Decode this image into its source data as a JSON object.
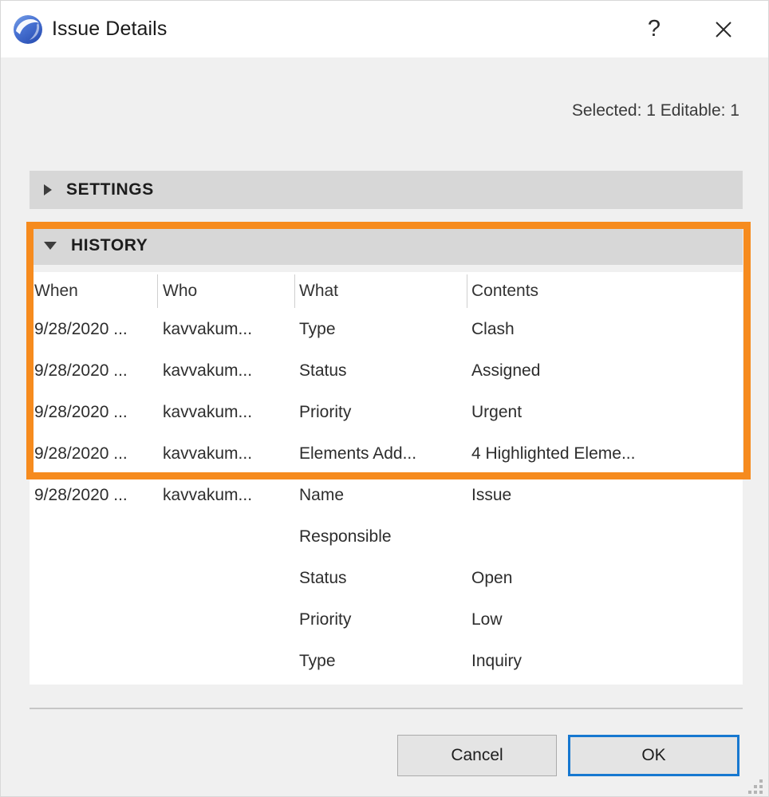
{
  "window": {
    "title": "Issue Details",
    "app_icon": "archicad-issue-icon",
    "help_label": "?",
    "close_label": "✕"
  },
  "status": {
    "text": "Selected: 1 Editable: 1"
  },
  "sections": [
    {
      "label": "SETTINGS",
      "expanded": false,
      "icon": "triangle-right-icon"
    },
    {
      "label": "HISTORY",
      "expanded": true,
      "icon": "triangle-down-icon"
    }
  ],
  "history_table": {
    "columns": [
      "When",
      "Who",
      "What",
      "Contents"
    ],
    "rows": [
      {
        "when": "9/28/2020 ...",
        "who": "kavvakum...",
        "what": "Type",
        "contents": "Clash"
      },
      {
        "when": "9/28/2020 ...",
        "who": "kavvakum...",
        "what": "Status",
        "contents": "Assigned"
      },
      {
        "when": "9/28/2020 ...",
        "who": "kavvakum...",
        "what": "Priority",
        "contents": "Urgent"
      },
      {
        "when": "9/28/2020 ...",
        "who": "kavvakum...",
        "what": "Elements Add...",
        "contents": "4 Highlighted Eleme..."
      },
      {
        "when": "9/28/2020 ...",
        "who": "kavvakum...",
        "what": "Name",
        "contents": "Issue"
      },
      {
        "when": "",
        "who": "",
        "what": "Responsible",
        "contents": ""
      },
      {
        "when": "",
        "who": "",
        "what": "Status",
        "contents": "Open"
      },
      {
        "when": "",
        "who": "",
        "what": "Priority",
        "contents": "Low"
      },
      {
        "when": "",
        "who": "",
        "what": "Type",
        "contents": "Inquiry"
      }
    ]
  },
  "scrollbar": {
    "up_icon": "chevron-up-icon",
    "down_icon": "chevron-down-icon"
  },
  "footer": {
    "cancel_label": "Cancel",
    "ok_label": "OK"
  },
  "colors": {
    "highlight": "#f68b1e",
    "focus_blue": "#1778d0",
    "section_bar": "#d7d7d7",
    "dialog_bg": "#f0f0f0",
    "scroll_thumb": "#cdcdcd"
  }
}
